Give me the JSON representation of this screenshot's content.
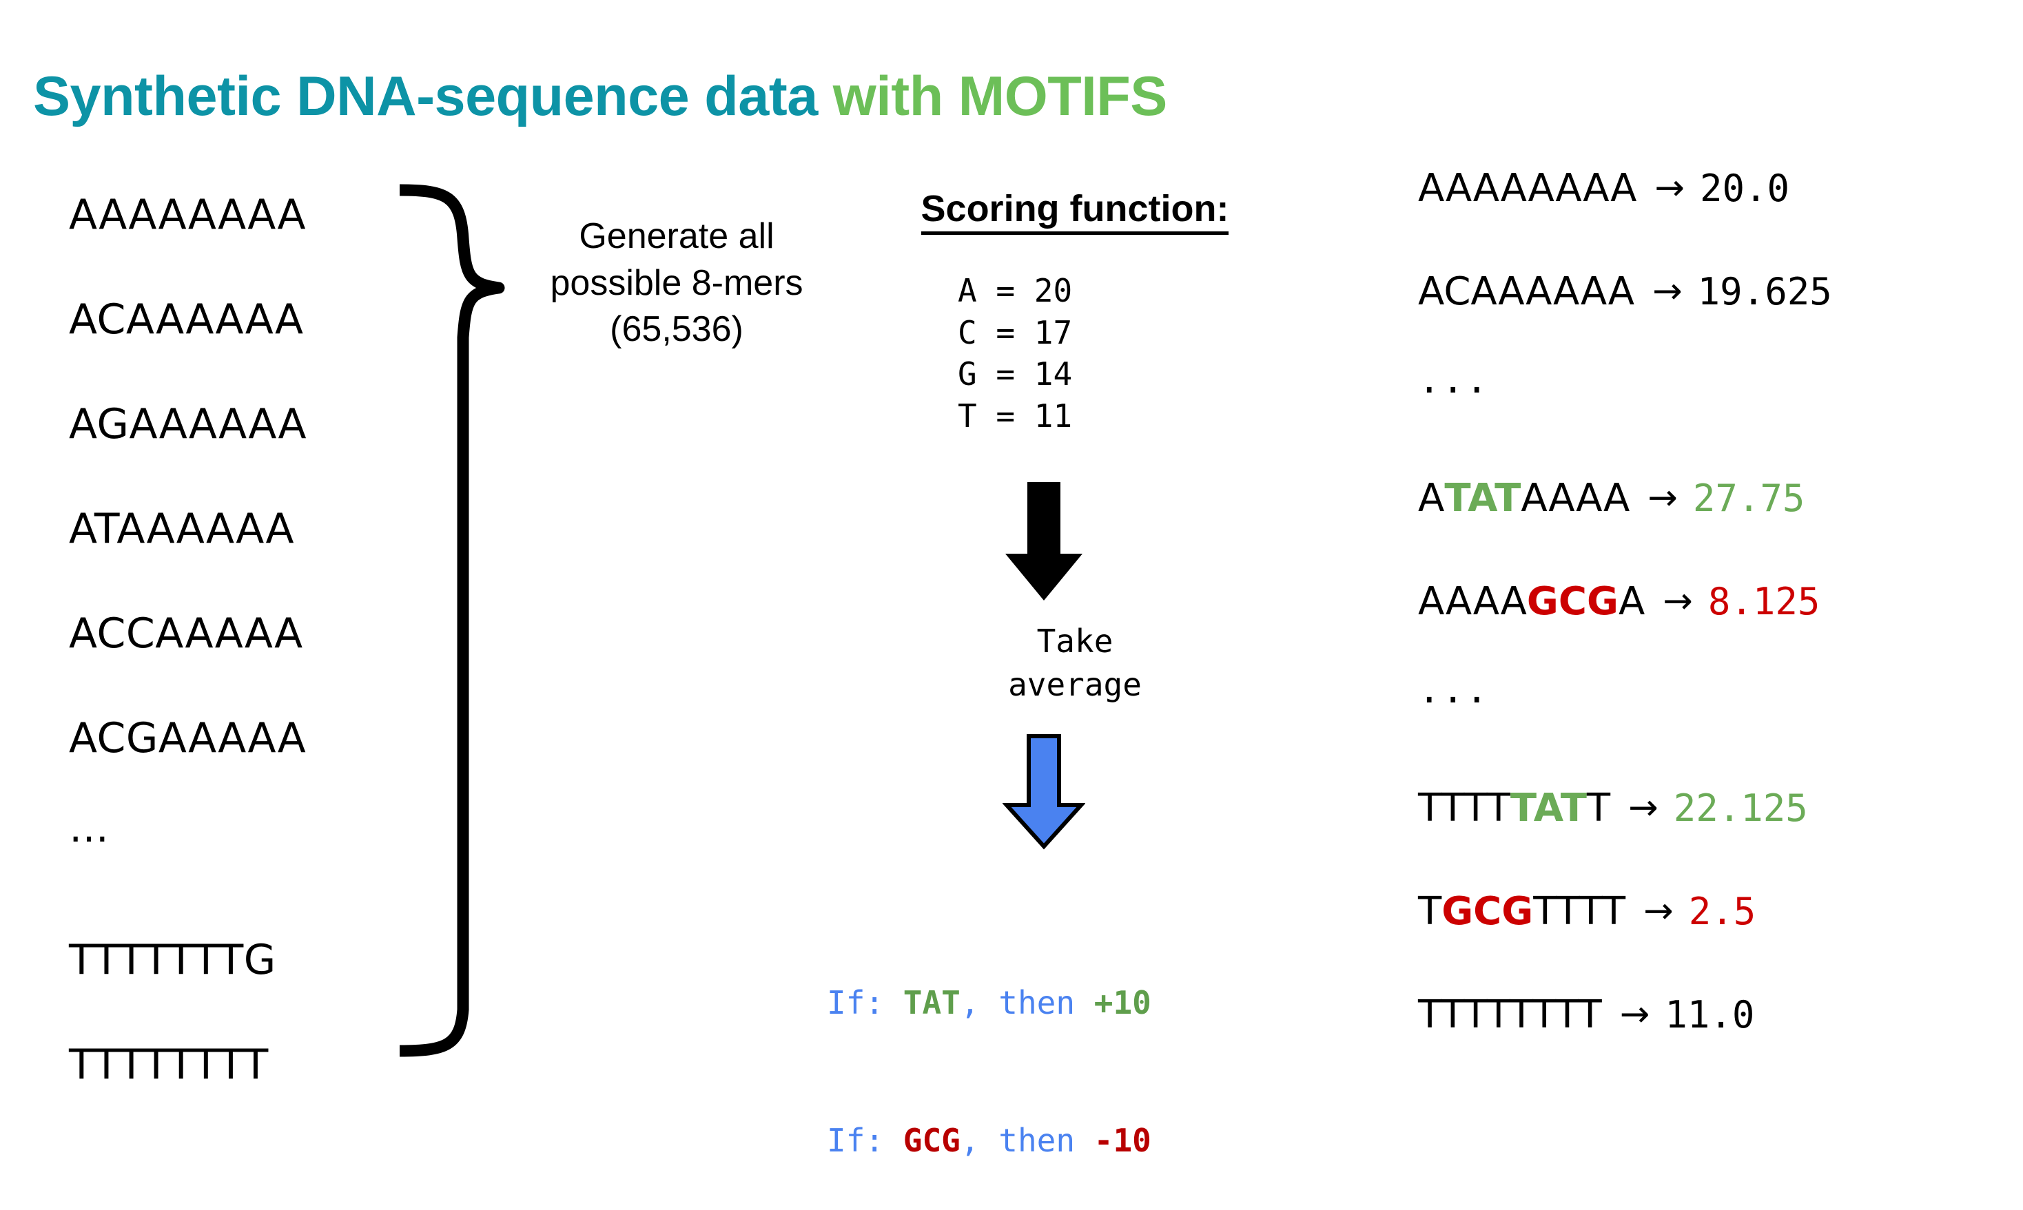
{
  "title": {
    "main": "Synthetic DNA-sequence data",
    "accent": " with MOTIFS",
    "main_color": "#0D93A6",
    "accent_color": "#6CBF58"
  },
  "kmer_list": {
    "items": [
      {
        "text": "AAAAAAAA",
        "kind": "seq"
      },
      {
        "text": "ACAAAAAA",
        "kind": "seq"
      },
      {
        "text": "AGAAAAAA",
        "kind": "seq"
      },
      {
        "text": "ATAAAAAA",
        "kind": "seq"
      },
      {
        "text": "ACCAAAAA",
        "kind": "seq"
      },
      {
        "text": "ACGAAAAA",
        "kind": "seq"
      },
      {
        "text": "…",
        "kind": "ellipsis"
      },
      {
        "text": "TTTTTTTG",
        "kind": "seq"
      },
      {
        "text": "TTTTTTTT",
        "kind": "seq"
      }
    ]
  },
  "brace_caption": {
    "line1": "Generate all",
    "line2": "possible 8-mers",
    "line3": "(65,536)"
  },
  "scoring": {
    "heading": "Scoring function:",
    "rows": [
      {
        "base": "A",
        "eq": "=",
        "value": "20"
      },
      {
        "base": "C",
        "eq": "=",
        "value": "17"
      },
      {
        "base": "G",
        "eq": "=",
        "value": "14"
      },
      {
        "base": "T",
        "eq": "=",
        "value": "11"
      }
    ],
    "lines": [
      "A = 20",
      "C = 17",
      "G = 14",
      "T = 11"
    ]
  },
  "flow": {
    "black_arrow_color": "#000000",
    "take_average_line1": "Take",
    "take_average_line2": "average",
    "blue_arrow_fill": "#4A82F0",
    "blue_arrow_stroke": "#000000"
  },
  "rules": {
    "line1": {
      "if": "If: ",
      "motif": "TAT",
      "mid": ", then ",
      "delta": "+10",
      "motif_color": "#5F9E4C",
      "delta_color": "#5F9E4C"
    },
    "line2": {
      "if": "If: ",
      "motif": "GCG",
      "mid": ", then ",
      "delta": "-10",
      "motif_color": "#B80000",
      "delta_color": "#B80000"
    },
    "text_color": "#4A82F0"
  },
  "results": {
    "arrow": "→",
    "rows": [
      {
        "kind": "row",
        "pre": "AAAAAAAA",
        "motif": "",
        "post": "",
        "motif_class": "",
        "value": "20.0",
        "value_class": "val-black"
      },
      {
        "kind": "row",
        "pre": "ACAAAAAA",
        "motif": "",
        "post": "",
        "motif_class": "",
        "value": "19.625",
        "value_class": "val-black"
      },
      {
        "kind": "ellipsis",
        "text": "..."
      },
      {
        "kind": "row",
        "pre": "A",
        "motif": "TAT",
        "post": "AAAA",
        "motif_class": "seq-green",
        "value": "27.75",
        "value_class": "val-green"
      },
      {
        "kind": "row",
        "pre": "AAAA",
        "motif": "GCG",
        "post": "A",
        "motif_class": "seq-red",
        "value": "8.125",
        "value_class": "val-red"
      },
      {
        "kind": "ellipsis",
        "text": "..."
      },
      {
        "kind": "row",
        "pre": "TTTT",
        "motif": "TAT",
        "post": "T",
        "motif_class": "seq-green",
        "value": "22.125",
        "value_class": "val-green"
      },
      {
        "kind": "row",
        "pre": "T",
        "motif": "GCG",
        "post": "TTTT",
        "motif_class": "seq-red",
        "value": "2.5",
        "value_class": "val-red"
      },
      {
        "kind": "row",
        "pre": "TTTTTTTT",
        "motif": "",
        "post": "",
        "motif_class": "",
        "value": "11.0",
        "value_class": "val-black"
      }
    ]
  }
}
